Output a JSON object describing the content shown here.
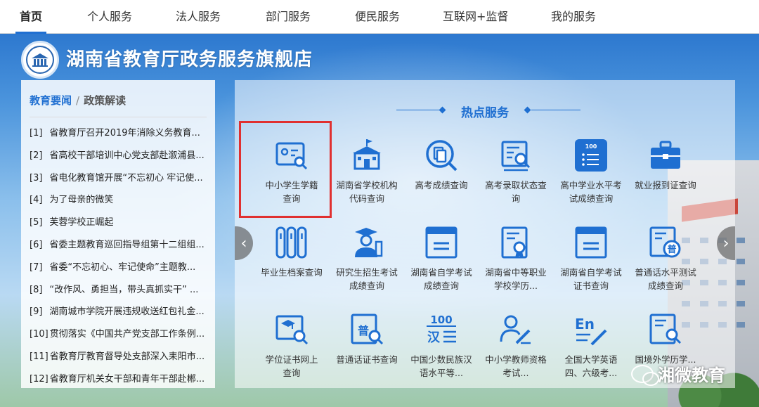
{
  "nav": {
    "items": [
      {
        "label": "首页",
        "active": true
      },
      {
        "label": "个人服务"
      },
      {
        "label": "法人服务"
      },
      {
        "label": "部门服务"
      },
      {
        "label": "便民服务"
      },
      {
        "label": "互联网+监督"
      },
      {
        "label": "我的服务"
      }
    ]
  },
  "header": {
    "title": "湖南省教育厅政务服务旗舰店"
  },
  "news": {
    "tab_active": "教育要闻",
    "separator": "/",
    "tab_other": "政策解读",
    "items": [
      {
        "idx": "[1]",
        "text": "省教育厅召开2019年消除义务教育..."
      },
      {
        "idx": "[2]",
        "text": "省高校干部培训中心党支部赴溆浦县..."
      },
      {
        "idx": "[3]",
        "text": "省电化教育馆开展“不忘初心 牢记使..."
      },
      {
        "idx": "[4]",
        "text": "为了母亲的微笑"
      },
      {
        "idx": "[5]",
        "text": "芙蓉学校正崛起"
      },
      {
        "idx": "[6]",
        "text": "省委主题教育巡回指导组第十二组组..."
      },
      {
        "idx": "[7]",
        "text": "省委“不忘初心、牢记使命”主题教..."
      },
      {
        "idx": "[8]",
        "text": "“改作风、勇担当，带头真抓实干” ..."
      },
      {
        "idx": "[9]",
        "text": "湖南城市学院开展违规收送红包礼金..."
      },
      {
        "idx": "[10]",
        "text": "贯彻落实《中国共产党支部工作条例..."
      },
      {
        "idx": "[11]",
        "text": "省教育厅教育督导处支部深入耒阳市..."
      },
      {
        "idx": "[12]",
        "text": "省教育厅机关女干部和青年干部赴郴..."
      }
    ]
  },
  "services": {
    "title": "热点服务",
    "items": [
      {
        "label": "中小学生学籍查询",
        "icon": "student-id-search-icon"
      },
      {
        "label": "湖南省学校机构代码查询",
        "icon": "school-building-icon"
      },
      {
        "label": "高考成绩查询",
        "icon": "document-search-icon"
      },
      {
        "label": "高考录取状态查询",
        "icon": "admission-search-icon"
      },
      {
        "label": "高中学业水平考试成绩查询",
        "icon": "score-list-icon",
        "badge": "100"
      },
      {
        "label": "就业报到证查询",
        "icon": "briefcase-icon"
      },
      {
        "label": "毕业生档案查询",
        "icon": "archive-binders-icon"
      },
      {
        "label": "研究生招生考试成绩查询",
        "icon": "graduate-icon"
      },
      {
        "label": "湖南省自学考试成绩查询",
        "icon": "window-doc-icon"
      },
      {
        "label": "湖南省中等职业学校学历...",
        "icon": "certificate-ribbon-icon"
      },
      {
        "label": "湖南省自学考试证书查询",
        "icon": "window-doc-icon"
      },
      {
        "label": "普通话水平测试成绩查询",
        "icon": "putonghua-badge-icon",
        "badge": "普"
      },
      {
        "label": "学位证书网上查询",
        "icon": "degree-cert-search-icon"
      },
      {
        "label": "普通话证书查询",
        "icon": "putonghua-cert-search-icon",
        "badge": "普"
      },
      {
        "label": "中国少数民族汉语水平等...",
        "icon": "han-100-icon",
        "badge": "100",
        "badge2": "汉"
      },
      {
        "label": "中小学教师资格考试...",
        "icon": "teacher-pen-icon"
      },
      {
        "label": "全国大学英语四、六级考...",
        "icon": "english-en-icon",
        "badge": "En"
      },
      {
        "label": "国境外学历学...",
        "icon": "foreign-degree-icon"
      }
    ]
  },
  "watermark": {
    "text": "湘微教育"
  },
  "colors": {
    "accent": "#1f6fd1",
    "highlight": "#e03030"
  }
}
